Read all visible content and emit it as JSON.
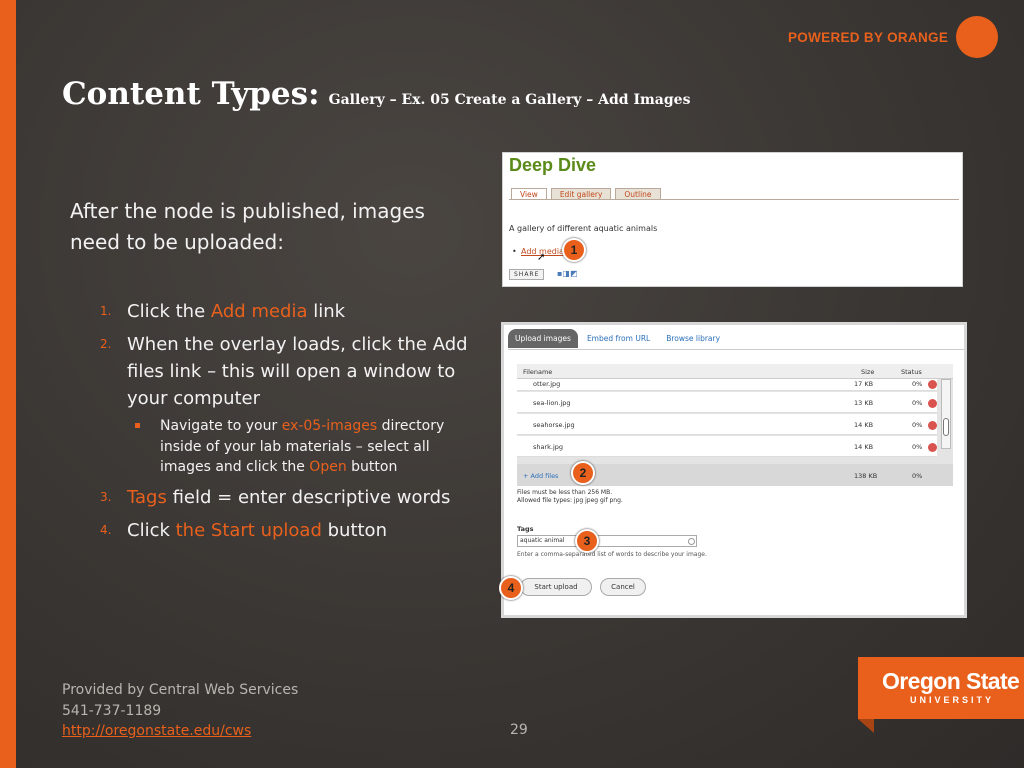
{
  "brand": {
    "powered_by": "POWERED BY ORANGE",
    "logo_name": "Oregon State",
    "logo_university": "UNIVERSITY",
    "accent_color": "#e8601c"
  },
  "slide": {
    "title_main": "Content Types:",
    "title_sub": "Gallery – Ex. 05 Create a Gallery – Add Images",
    "intro": "After the node is published, images need to be uploaded:",
    "steps": [
      {
        "num": "1.",
        "before": "Click the ",
        "highlight": "Add media",
        "after": " link"
      },
      {
        "num": "2.",
        "text": "When the overlay loads, click the Add files link – this will open a window to your computer"
      },
      {
        "num": "3.",
        "highlight": "Tags",
        "after": " field = enter descriptive words"
      },
      {
        "num": "4.",
        "before": "Click ",
        "highlight": "the Start upload",
        "after": " button"
      }
    ],
    "substep": {
      "before": "Navigate to your ",
      "highlight1": "ex-05-images",
      "middle": " directory inside of your lab materials – select all images and click the ",
      "highlight2": "Open",
      "after": " button"
    }
  },
  "footer": {
    "provider": "Provided by Central Web Services",
    "phone": "541-737-1189",
    "url": "http://oregonstate.edu/cws",
    "page_number": "29"
  },
  "screenshot1": {
    "title": "Deep Dive",
    "tabs": [
      "View",
      "Edit gallery",
      "Outline"
    ],
    "description": "A gallery of different aquatic animals",
    "bullet": "•",
    "link": "Add media",
    "cursor": "➚",
    "share_label": "SHARE",
    "share_icons": "▪◨◩",
    "badge": "1"
  },
  "screenshot2": {
    "tabs": [
      "Upload images",
      "Embed from URL",
      "Browse library"
    ],
    "columns": {
      "filename": "Filename",
      "size": "Size",
      "status": "Status"
    },
    "files": [
      {
        "name": "otter.jpg",
        "size": "17 KB",
        "status": "0%"
      },
      {
        "name": "sea-lion.jpg",
        "size": "13 KB",
        "status": "0%"
      },
      {
        "name": "seahorse.jpg",
        "size": "14 KB",
        "status": "0%"
      },
      {
        "name": "shark.jpg",
        "size": "14 KB",
        "status": "0%"
      }
    ],
    "add_files": "+ Add files",
    "total_size": "138 KB",
    "total_status": "0%",
    "limit_line1": "Files must be less than 256 MB.",
    "limit_line2": "Allowed file types: jpg jpeg gif png.",
    "tags_label": "Tags",
    "tags_value": "aquatic animal",
    "tags_help": "Enter a comma-separated list of words to describe your image.",
    "start_upload": "Start upload",
    "cancel": "Cancel",
    "badges": [
      "2",
      "3",
      "4"
    ]
  }
}
